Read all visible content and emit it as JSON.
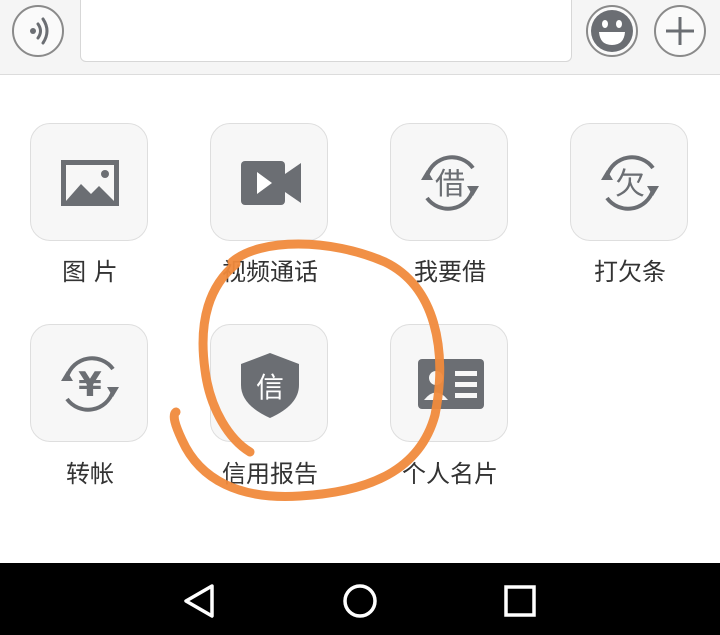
{
  "input": {
    "value": "",
    "placeholder": ""
  },
  "topbar": {
    "voice_icon": "voice-wave-icon",
    "emoji_icon": "smiley-face-icon",
    "plus_icon": "plus-icon"
  },
  "grid": {
    "items": [
      {
        "label": "图 片",
        "icon": "picture-icon"
      },
      {
        "label": "视频通话",
        "icon": "video-camera-icon"
      },
      {
        "label": "我要借",
        "icon": "borrow-icon"
      },
      {
        "label": "打欠条",
        "icon": "iou-icon"
      },
      {
        "label": "转帐",
        "icon": "yuan-transfer-icon"
      },
      {
        "label": "信用报告",
        "icon": "credit-shield-icon",
        "icon_text": "信"
      },
      {
        "label": "个人名片",
        "icon": "contact-card-icon"
      }
    ]
  },
  "icon_glyphs": {
    "borrow": "借",
    "iou": "欠",
    "yuan": "¥"
  },
  "colors": {
    "icon_gray": "#6b6e73",
    "annotation_orange": "#f08a3c",
    "nav_bg": "#000000"
  },
  "navbar": {
    "back_icon": "back-triangle-icon",
    "home_icon": "home-circle-icon",
    "recents_icon": "recents-square-icon"
  }
}
